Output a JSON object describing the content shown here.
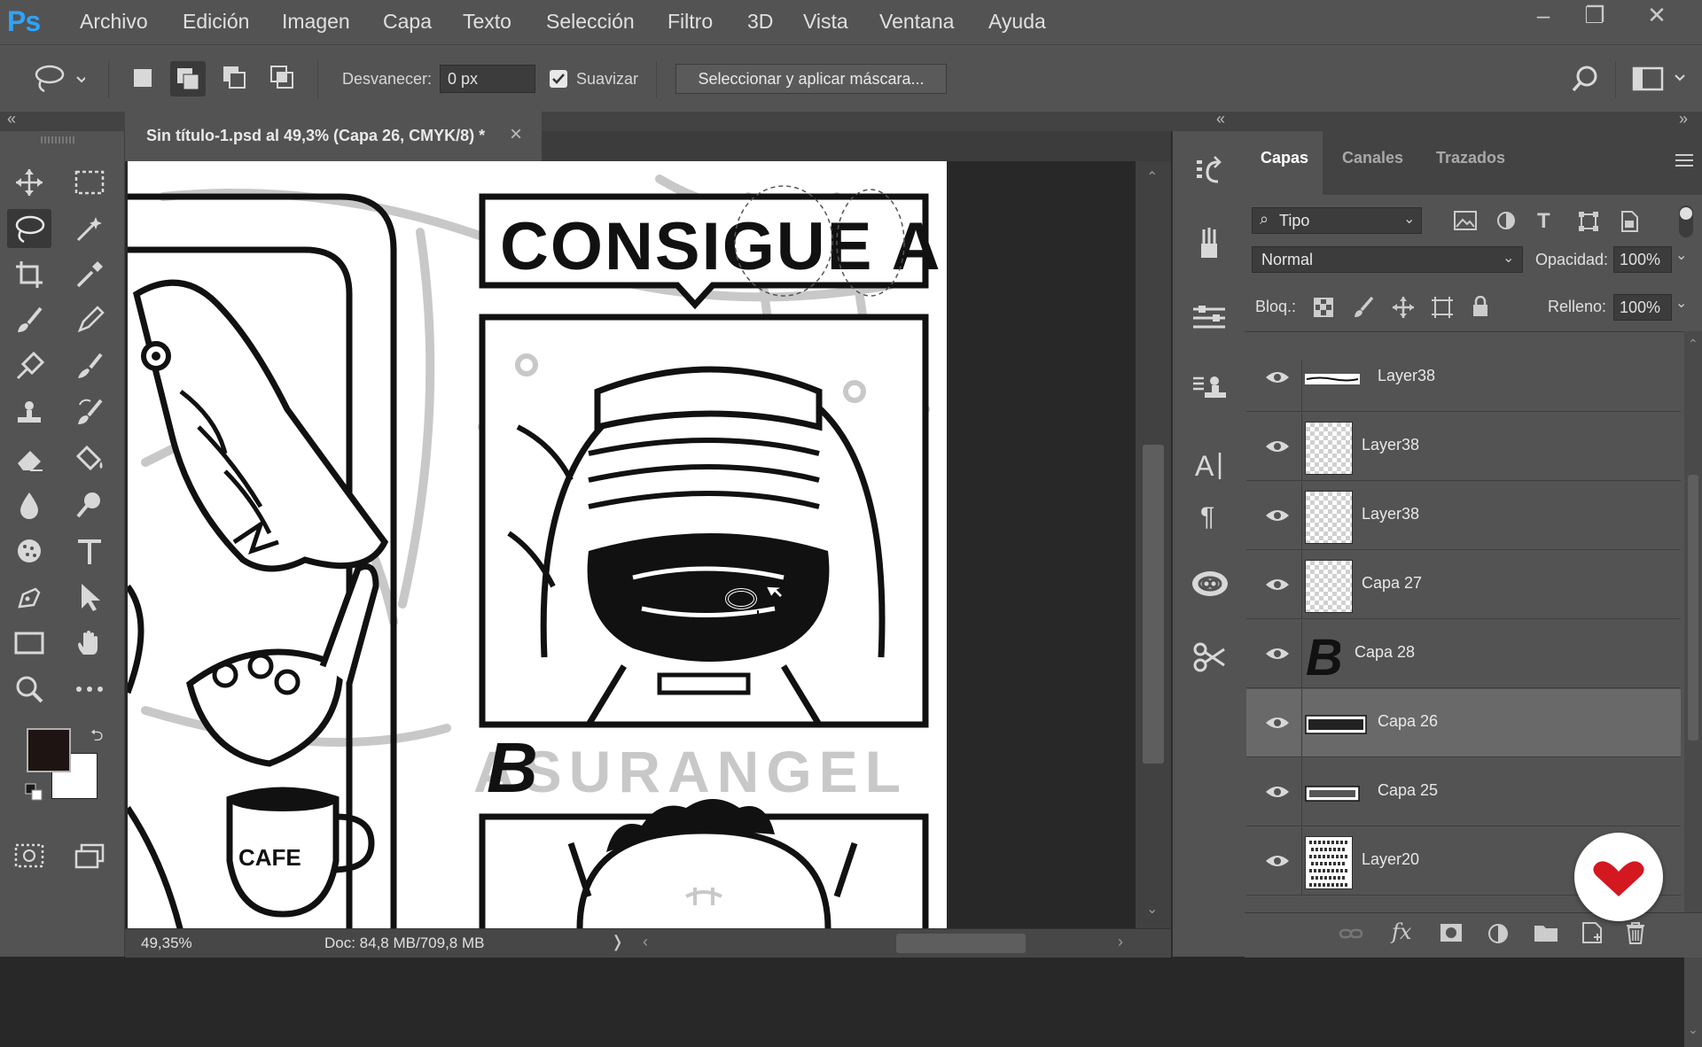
{
  "app": {
    "logo": "Ps"
  },
  "menu": [
    "Archivo",
    "Edición",
    "Imagen",
    "Capa",
    "Texto",
    "Selección",
    "Filtro",
    "3D",
    "Vista",
    "Ventana",
    "Ayuda"
  ],
  "options_bar": {
    "feather_label": "Desvanecer:",
    "feather_value": "0 px",
    "antialias_label": "Suavizar",
    "antialias_checked": true,
    "select_mask_button": "Seleccionar y aplicar máscara..."
  },
  "document": {
    "tab_title": "Sin título-1.psd al 49,3% (Capa 26, CMYK/8) *",
    "close_glyph": "×",
    "zoom": "49,35%",
    "doc_info": "Doc: 84,8 MB/709,8 MB"
  },
  "artwork": {
    "headline": "CONSIGUE A:",
    "cup_label": "CAFE",
    "big_letter": "B",
    "sketch_text": "ASURANGEL"
  },
  "collapse": {
    "left": "«",
    "mid": "«",
    "right": "»"
  },
  "layers_panel": {
    "tabs": [
      {
        "label": "Capas",
        "active": true
      },
      {
        "label": "Canales",
        "active": false
      },
      {
        "label": "Trazados",
        "active": false
      }
    ],
    "filter_kind": "Tipo",
    "blend_mode": "Normal",
    "opacity_label": "Opacidad:",
    "opacity_value": "100%",
    "lock_label": "Bloq.:",
    "fill_label": "Relleno:",
    "fill_value": "100%",
    "layers": [
      {
        "name": "Layer38",
        "thumb": "line",
        "visible": true,
        "selected": false
      },
      {
        "name": "Layer38",
        "thumb": "transparent",
        "visible": true,
        "selected": false
      },
      {
        "name": "Layer38",
        "thumb": "transparent",
        "visible": true,
        "selected": false
      },
      {
        "name": "Capa 27",
        "thumb": "transparent",
        "visible": true,
        "selected": false
      },
      {
        "name": "Capa 28",
        "thumb": "letter-b",
        "visible": true,
        "selected": false
      },
      {
        "name": "Capa 26",
        "thumb": "consigue-text",
        "visible": true,
        "selected": true
      },
      {
        "name": "Capa 25",
        "thumb": "text-banner",
        "visible": true,
        "selected": false
      },
      {
        "name": "Layer20",
        "thumb": "noise",
        "visible": true,
        "selected": false
      }
    ]
  },
  "colors": {
    "foreground": "#1e1412",
    "background": "#ffffff",
    "accent": "#2fa3f7",
    "brand_badge": "#d4181f"
  }
}
